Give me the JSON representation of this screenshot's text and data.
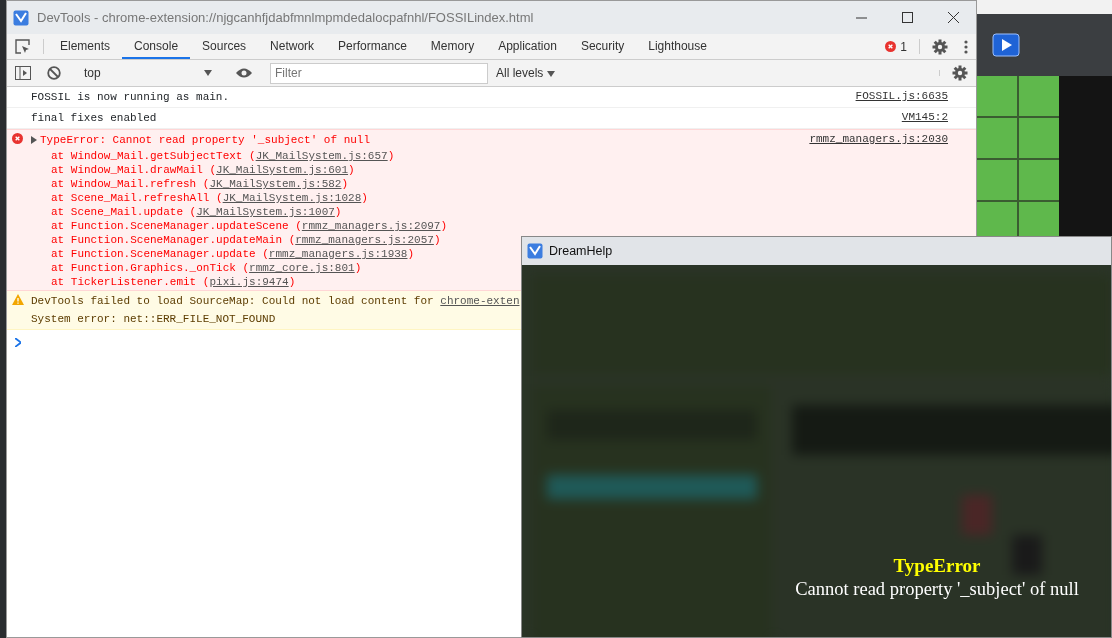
{
  "devtools": {
    "title": "DevTools - chrome-extension://njgcanhfjdabfmnlmpmdedalocpafnhl/FOSSILindex.html",
    "tabs": [
      {
        "label": "Elements",
        "selected": false
      },
      {
        "label": "Console",
        "selected": true
      },
      {
        "label": "Sources",
        "selected": false
      },
      {
        "label": "Network",
        "selected": false
      },
      {
        "label": "Performance",
        "selected": false
      },
      {
        "label": "Memory",
        "selected": false
      },
      {
        "label": "Application",
        "selected": false
      },
      {
        "label": "Security",
        "selected": false
      },
      {
        "label": "Lighthouse",
        "selected": false
      }
    ],
    "error_count": "1",
    "console_toolbar": {
      "context": "top",
      "filter": {
        "placeholder": "Filter"
      },
      "levels": "All levels"
    },
    "messages": [
      {
        "kind": "log",
        "text": "FOSSIL is now running as main.",
        "source": "FOSSIL.js:6635"
      },
      {
        "kind": "log",
        "text": "final fixes enabled",
        "source": "VM145:2"
      },
      {
        "kind": "error",
        "text": "TypeError: Cannot read property '_subject' of null",
        "source": "rmmz_managers.js:2030",
        "stack": [
          {
            "text": "at Window_Mail.getSubjectText (",
            "source": "JK_MailSystem.js:657",
            "close": ")"
          },
          {
            "text": "at Window_Mail.drawMail (",
            "source": "JK_MailSystem.js:601",
            "close": ")"
          },
          {
            "text": "at Window_Mail.refresh (",
            "source": "JK_MailSystem.js:582",
            "close": ")"
          },
          {
            "text": "at Scene_Mail.refreshAll (",
            "source": "JK_MailSystem.js:1028",
            "close": ")"
          },
          {
            "text": "at Scene_Mail.update (",
            "source": "JK_MailSystem.js:1007",
            "close": ")"
          },
          {
            "text": "at Function.SceneManager.updateScene (",
            "source": "rmmz_managers.js:2097",
            "close": ")"
          },
          {
            "text": "at Function.SceneManager.updateMain (",
            "source": "rmmz_managers.js:2057",
            "close": ")"
          },
          {
            "text": "at Function.SceneManager.update (",
            "source": "rmmz_managers.js:1938",
            "close": ")"
          },
          {
            "text": "at Function.Graphics._onTick (",
            "source": "rmmz_core.js:801",
            "close": ")"
          },
          {
            "text": "at TickerListener.emit (",
            "source": "pixi.js:9474",
            "close": ")"
          }
        ]
      },
      {
        "kind": "warning",
        "text": "DevTools failed to load SourceMap: Could not load content for ",
        "link": "chrome-exten",
        "detail": "System error: net::ERR_FILE_NOT_FOUND"
      }
    ]
  },
  "dreamhelp": {
    "title": "DreamHelp",
    "error_title": "TypeError",
    "error_message": "Cannot read property '_subject' of null"
  }
}
